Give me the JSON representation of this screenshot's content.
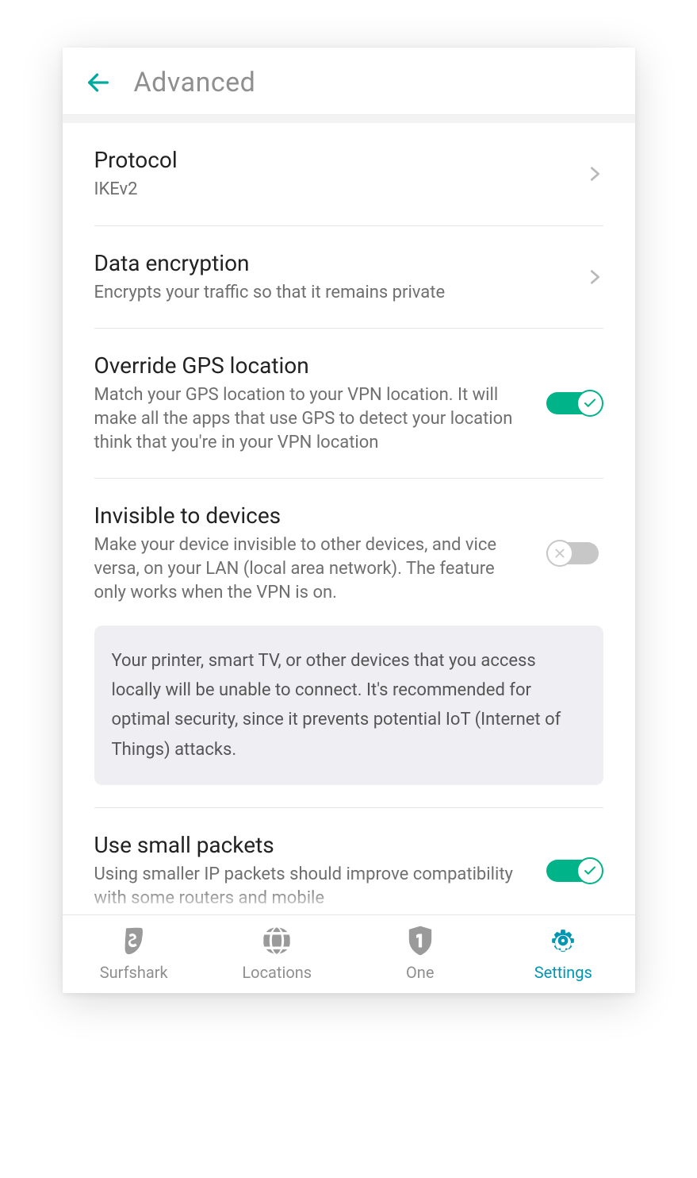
{
  "header": {
    "title": "Advanced"
  },
  "rows": {
    "protocol": {
      "title": "Protocol",
      "sub": "IKEv2"
    },
    "encryption": {
      "title": "Data encryption",
      "sub": "Encrypts your traffic so that it remains private"
    },
    "gps": {
      "title": "Override GPS location",
      "sub": "Match your GPS location to your VPN location. It will make all the apps that use GPS to detect your location think that you're in your VPN location"
    },
    "invisible": {
      "title": "Invisible to devices",
      "sub": "Make your device invisible to other devices, and vice versa, on your LAN (local area network). The feature only works when the VPN is on."
    },
    "info": "Your printer, smart TV, or other devices that you access locally will be unable to connect. It's recommended for optimal security, since it prevents potential IoT (Internet of Things) attacks.",
    "packets": {
      "title": "Use small packets",
      "sub": "Using smaller IP packets should improve compatibility with some routers and mobile"
    }
  },
  "nav": {
    "surfshark": "Surfshark",
    "locations": "Locations",
    "one": "One",
    "settings": "Settings"
  }
}
